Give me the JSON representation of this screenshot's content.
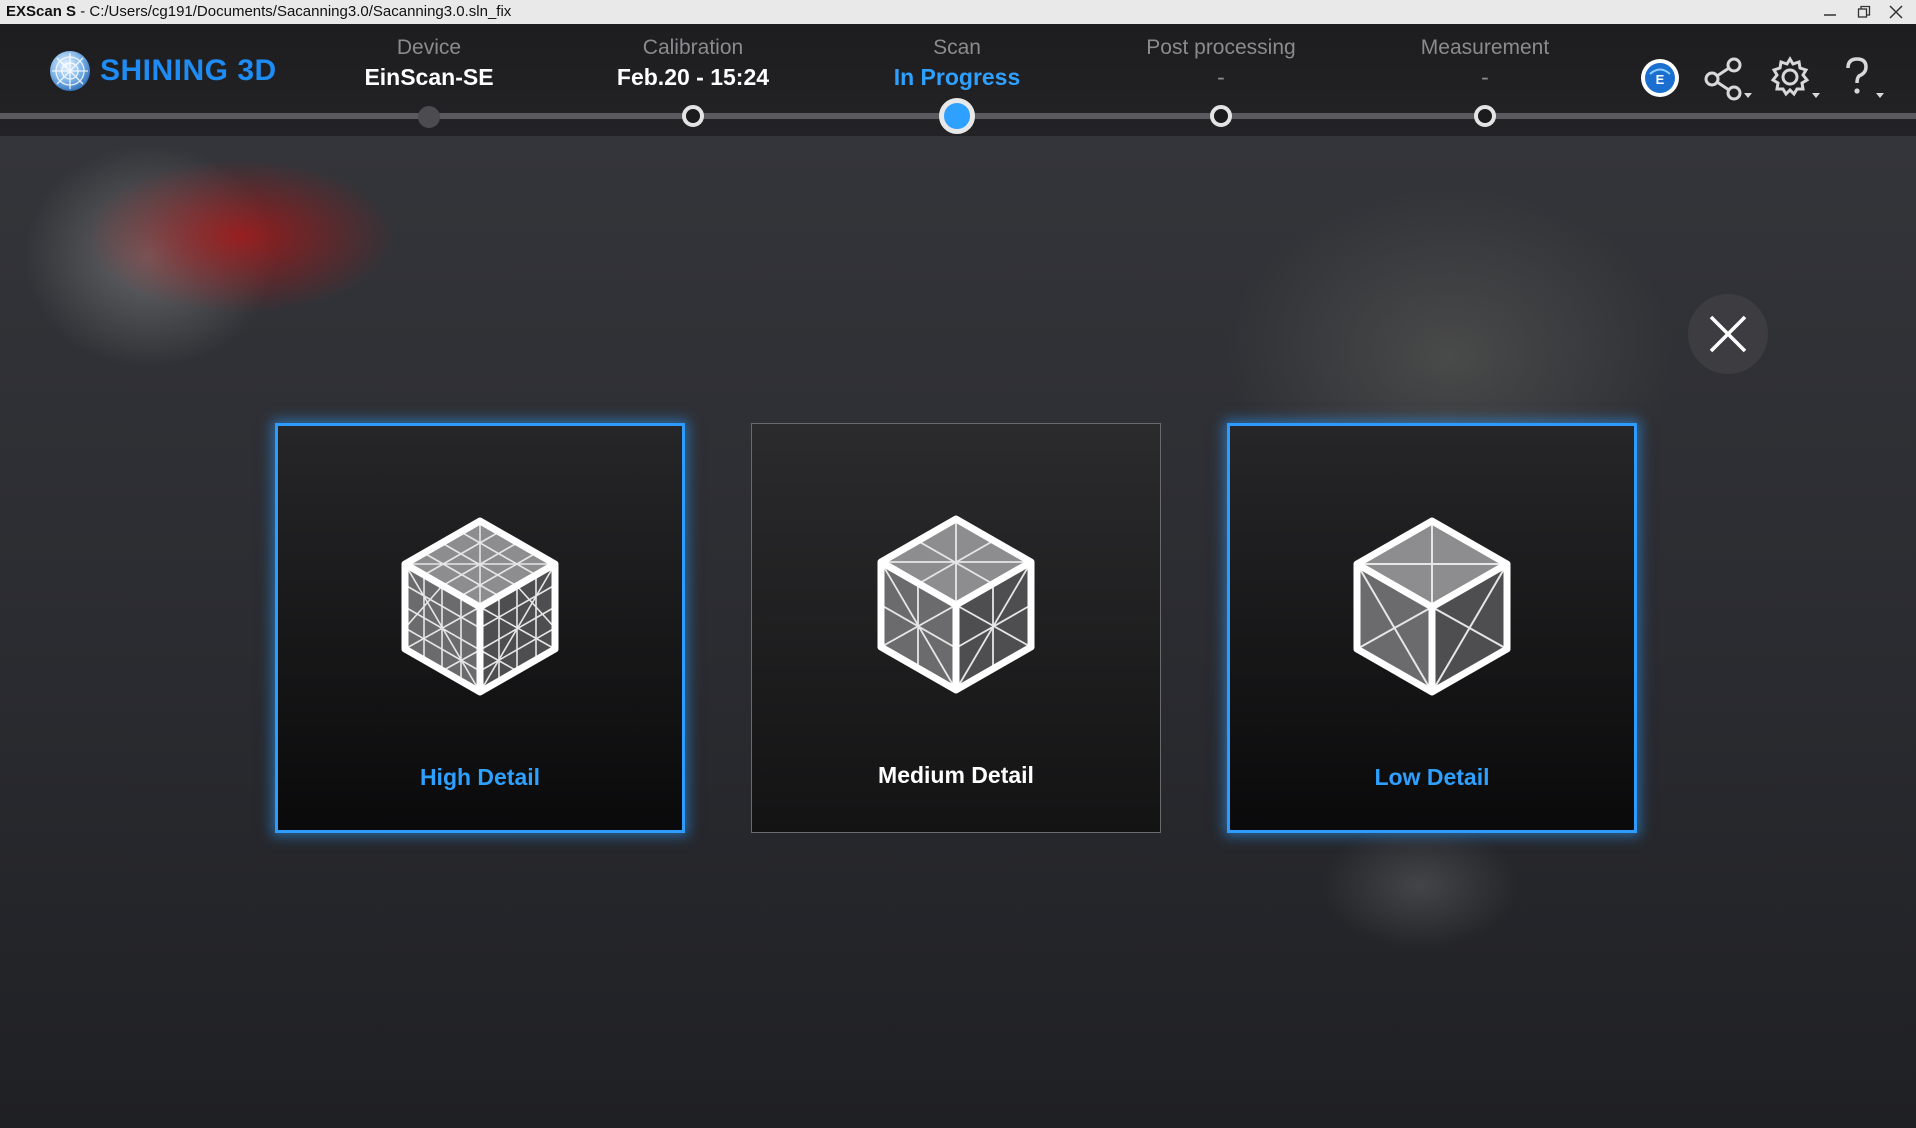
{
  "window": {
    "app_name": "EXScan S",
    "separator": " - ",
    "path": "C:/Users/cg191/Documents/Sacanning3.0/Sacanning3.0.sln_fix"
  },
  "header": {
    "brand": "SHINING 3D",
    "steps": [
      {
        "label": "Device",
        "value": "EinScan-SE",
        "state": "done"
      },
      {
        "label": "Calibration",
        "value": "Feb.20 - 15:24",
        "state": "open"
      },
      {
        "label": "Scan",
        "value": "In Progress",
        "state": "current"
      },
      {
        "label": "Post processing",
        "value": "-",
        "state": "open"
      },
      {
        "label": "Measurement",
        "value": "-",
        "state": "open"
      }
    ],
    "icons": [
      "exmodel-icon",
      "share-icon",
      "settings-icon",
      "help-icon"
    ],
    "accent_color": "#2ea0ff"
  },
  "detail_options": [
    {
      "label": "High Detail",
      "selected": true
    },
    {
      "label": "Medium Detail",
      "selected": false
    },
    {
      "label": "Low Detail",
      "selected": true
    }
  ]
}
